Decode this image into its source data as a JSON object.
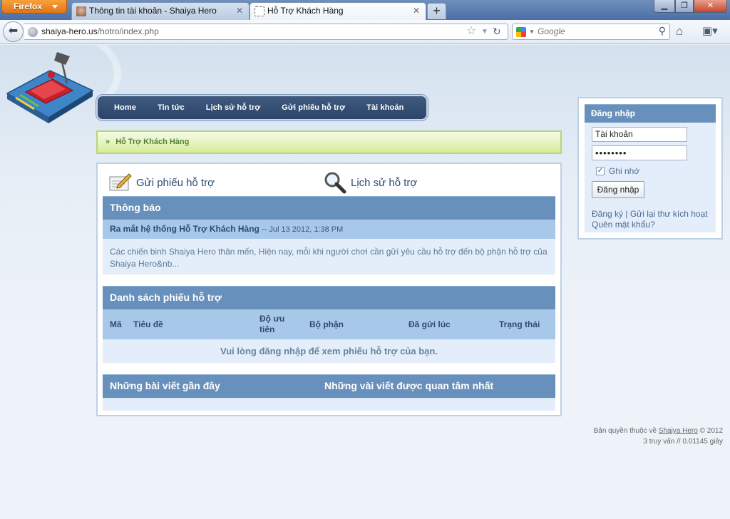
{
  "browser": {
    "app_button": "Firefox",
    "tabs": [
      {
        "title": "Thông tin tài khoản - Shaiya Hero"
      },
      {
        "title": "Hỗ Trợ Khách Hàng"
      }
    ],
    "url_host": "shaiya-hero.us",
    "url_path": "/hotro/index.php",
    "search_placeholder": "Google"
  },
  "site": {
    "menu": [
      "Home",
      "Tin tức",
      "Lịch sử hỗ trợ",
      "Gửi phiếu hỗ trợ",
      "Tài khoản"
    ],
    "breadcrumb": "Hỗ Trợ Khách Hàng",
    "actions": {
      "submit": "Gửi phiếu hỗ trợ",
      "history": "Lịch sử hỗ trợ"
    },
    "notice": {
      "heading": "Thông báo",
      "title": "Ra mắt hệ thống Hỗ Trợ Khách Hàng",
      "date": " -- Jul 13 2012, 1:38 PM",
      "body": "Các chiến binh Shaiya Hero thân mến, Hiện nay, mỗi khi người chơi cần gửi yêu cầu hỗ trợ đến bộ phận hỗ trợ của Shaiya Hero&nb..."
    },
    "tickets": {
      "heading": "Danh sách phiếu hỗ trợ",
      "columns": [
        "Mã",
        "Tiêu đề",
        "Độ ưu tiên",
        "Bộ phận",
        "Đã gửi lúc",
        "Trạng thái"
      ],
      "empty_message": "Vui lòng đăng nhập để xem phiếu hỗ trợ của bạn."
    },
    "posts": {
      "recent": "Những bài viết gần đây",
      "popular": "Những vài viết được quan tâm nhất"
    },
    "login": {
      "heading": "Đăng nhập",
      "username": "Tài khoản",
      "password_mask": "••••••••",
      "remember": "Ghi nhớ",
      "button": "Đăng nhập",
      "register": "Đăng ký",
      "separator": " | ",
      "resend": "Gửi lại thư kích hoạt",
      "forgot": "Quên mật khẩu?"
    },
    "footer": {
      "copyright_prefix": "Bản quyền thuộc về ",
      "copyright_link": "Shaiya Hero",
      "copyright_suffix": " © 2012",
      "stats": "3 truy vấn // 0.01145 giây"
    }
  },
  "colors": {
    "menu_bg": "#2c4468",
    "section_header": "#6890bc",
    "subheader": "#a8c8ea",
    "breadcrumb_bg": "#d6ec9b"
  }
}
